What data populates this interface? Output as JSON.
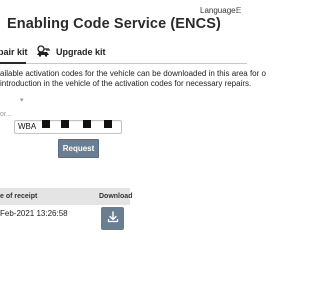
{
  "header": {
    "language_label": "Language:",
    "language_value": "E",
    "title": "Enabling Code Service (ENCS)"
  },
  "tabs": [
    {
      "label": "pair kit",
      "active": true
    },
    {
      "label": "Upgrade kit",
      "active": false,
      "icon": "car-key-icon"
    }
  ],
  "info": {
    "line1": "ailable activation codes for the vehicle can be downloaded in this area for o",
    "line2": "introduction in the vehicle of the activation codes for necessary repairs."
  },
  "form": {
    "vin_label": "or...",
    "vin_value": "WBA",
    "request_label": "Request"
  },
  "table": {
    "headers": [
      "e of receipt",
      "Download"
    ],
    "rows": [
      {
        "date": "Feb-2021 13:26:58"
      }
    ]
  },
  "colors": {
    "accent": "#6a7e92",
    "table_header_bg": "#e4e4e4"
  }
}
